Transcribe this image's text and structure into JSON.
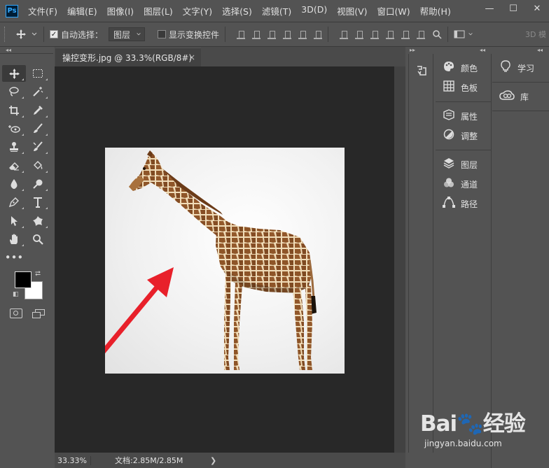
{
  "app": {
    "logo_text": "Ps",
    "menu": [
      "文件(F)",
      "编辑(E)",
      "图像(I)",
      "图层(L)",
      "文字(Y)",
      "选择(S)",
      "滤镜(T)",
      "3D(D)",
      "视图(V)",
      "窗口(W)",
      "帮助(H)"
    ],
    "window_controls": {
      "minimize": "—",
      "maximize": "☐",
      "close": "✕"
    }
  },
  "options": {
    "auto_select_label": "自动选择：",
    "auto_select_checked": true,
    "auto_select_target": "图层",
    "show_transform_label": "显示变换控件",
    "show_transform_checked": false,
    "mode_3d_label": "3D 模"
  },
  "document": {
    "tab_title": "操控变形.jpg @ 33.3%(RGB/8#)",
    "tab_close": "×",
    "zoom": "33.33%",
    "doc_info": "文档:2.85M/2.85M",
    "status_arrow": "❯"
  },
  "colors": {
    "foreground": "#000000",
    "background": "#ffffff",
    "annotation_arrow": "#e8202a"
  },
  "tools": [
    [
      "move-tool",
      "marquee-tool"
    ],
    [
      "lasso-tool",
      "magic-wand-tool"
    ],
    [
      "crop-tool",
      "eyedropper-tool"
    ],
    [
      "spot-heal-tool",
      "brush-tool"
    ],
    [
      "clone-stamp-tool",
      "history-brush-tool"
    ],
    [
      "eraser-tool",
      "paint-bucket-tool"
    ],
    [
      "blur-tool",
      "dodge-tool"
    ],
    [
      "pen-tool",
      "type-tool"
    ],
    [
      "path-select-tool",
      "custom-shape-tool"
    ],
    [
      "hand-tool",
      "zoom-tool"
    ],
    [
      "more-tools"
    ]
  ],
  "panels": {
    "group1": [
      {
        "label": "颜色",
        "icon": "palette-icon"
      },
      {
        "label": "色板",
        "icon": "grid-icon"
      }
    ],
    "group2": [
      {
        "label": "属性",
        "icon": "properties-icon"
      },
      {
        "label": "调整",
        "icon": "adjust-icon"
      }
    ],
    "group3": [
      {
        "label": "图层",
        "icon": "layers-icon"
      },
      {
        "label": "通道",
        "icon": "channels-icon"
      },
      {
        "label": "路径",
        "icon": "paths-icon"
      }
    ],
    "right": [
      {
        "label": "学习",
        "icon": "bulb-icon"
      },
      {
        "label": "库",
        "icon": "cc-libraries-icon"
      }
    ]
  },
  "watermark": {
    "logo": "Bai🐾经验",
    "url": "jingyan.baidu.com"
  }
}
